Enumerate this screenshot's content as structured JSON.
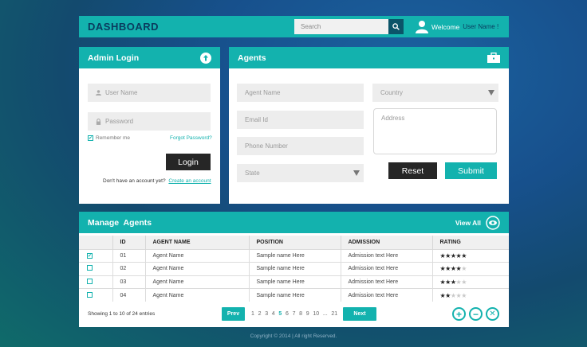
{
  "header": {
    "title": "DASHBOARD",
    "search_placeholder": "Search",
    "welcome": "Welcome",
    "user": "User Name !"
  },
  "login": {
    "title": "Admin Login",
    "username_placeholder": "User Name",
    "password_placeholder": "Password",
    "remember": "Remember me",
    "remember_checked": true,
    "forgot": "Forgot Password?",
    "button": "Login",
    "no_account": "Don't have an account yet?",
    "create": "Create an account"
  },
  "agents": {
    "title": "Agents",
    "agent_name": "Agent Name",
    "email": "Email Id",
    "phone": "Phone Number",
    "state": "State",
    "country": "Country",
    "address": "Address",
    "reset": "Reset",
    "submit": "Submit"
  },
  "manage": {
    "title": "Manage  Agents",
    "view_all": "View All",
    "columns": [
      "",
      "ID",
      "AGENT NAME",
      "POSITION",
      "ADMISSION",
      "RATING"
    ],
    "rows": [
      {
        "checked": true,
        "id": "01",
        "name": "Agent Name",
        "position": "Sample name Here",
        "admission": "Admission  text Here",
        "rating": 5
      },
      {
        "checked": false,
        "id": "02",
        "name": "Agent Name",
        "position": "Sample name Here",
        "admission": "Admission  text Here",
        "rating": 4
      },
      {
        "checked": false,
        "id": "03",
        "name": "Agent Name",
        "position": "Sample name Here",
        "admission": "Admission  text Here",
        "rating": 3
      },
      {
        "checked": false,
        "id": "04",
        "name": "Agent Name",
        "position": "Sample name Here",
        "admission": "Admission  text Here",
        "rating": 2
      }
    ],
    "showing": "Showing 1 to 10 of 24 entries",
    "prev": "Prev",
    "next": "Next",
    "pages": [
      "1",
      "2",
      "3",
      "4",
      "5",
      "6",
      "7",
      "8",
      "9",
      "10",
      "...",
      "21"
    ],
    "current_page": "5"
  },
  "footer": "Copyright © 2014 | All right Reserved.",
  "colors": {
    "accent": "#13b2ae",
    "dark": "#262626",
    "navy": "#0a3b5e"
  }
}
